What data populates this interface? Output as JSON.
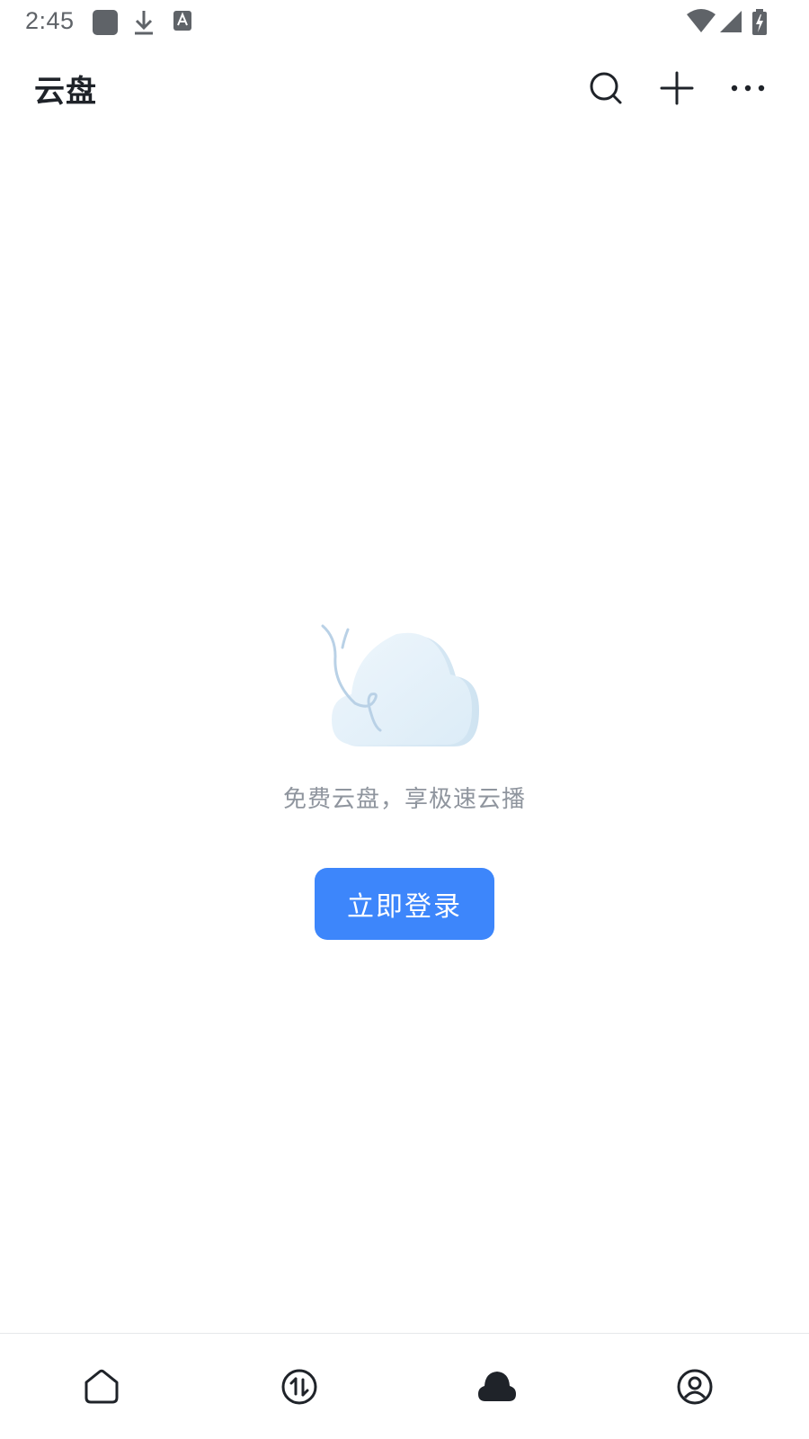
{
  "status_bar": {
    "time": "2:45",
    "notification_icons": [
      "app-notification-icon",
      "download-icon",
      "accessibility-icon"
    ],
    "system_icons": [
      "wifi-icon",
      "cell-signal-icon",
      "battery-charging-icon"
    ]
  },
  "header": {
    "title": "云盘",
    "actions": [
      "search-icon",
      "plus-icon",
      "more-icon"
    ]
  },
  "empty_state": {
    "illustration": "cloud-illustration",
    "message": "免费云盘，享极速云播",
    "login_label": "立即登录"
  },
  "bottom_nav": {
    "items": [
      {
        "icon": "home-icon",
        "active": false
      },
      {
        "icon": "transfer-icon",
        "active": false
      },
      {
        "icon": "cloud-icon",
        "active": true
      },
      {
        "icon": "profile-icon",
        "active": false
      }
    ]
  },
  "colors": {
    "accent": "#3d86fb",
    "title_text": "#1f2329",
    "secondary_text": "#8f959e",
    "status_text": "#5f6368",
    "divider": "#e6e8eb"
  }
}
